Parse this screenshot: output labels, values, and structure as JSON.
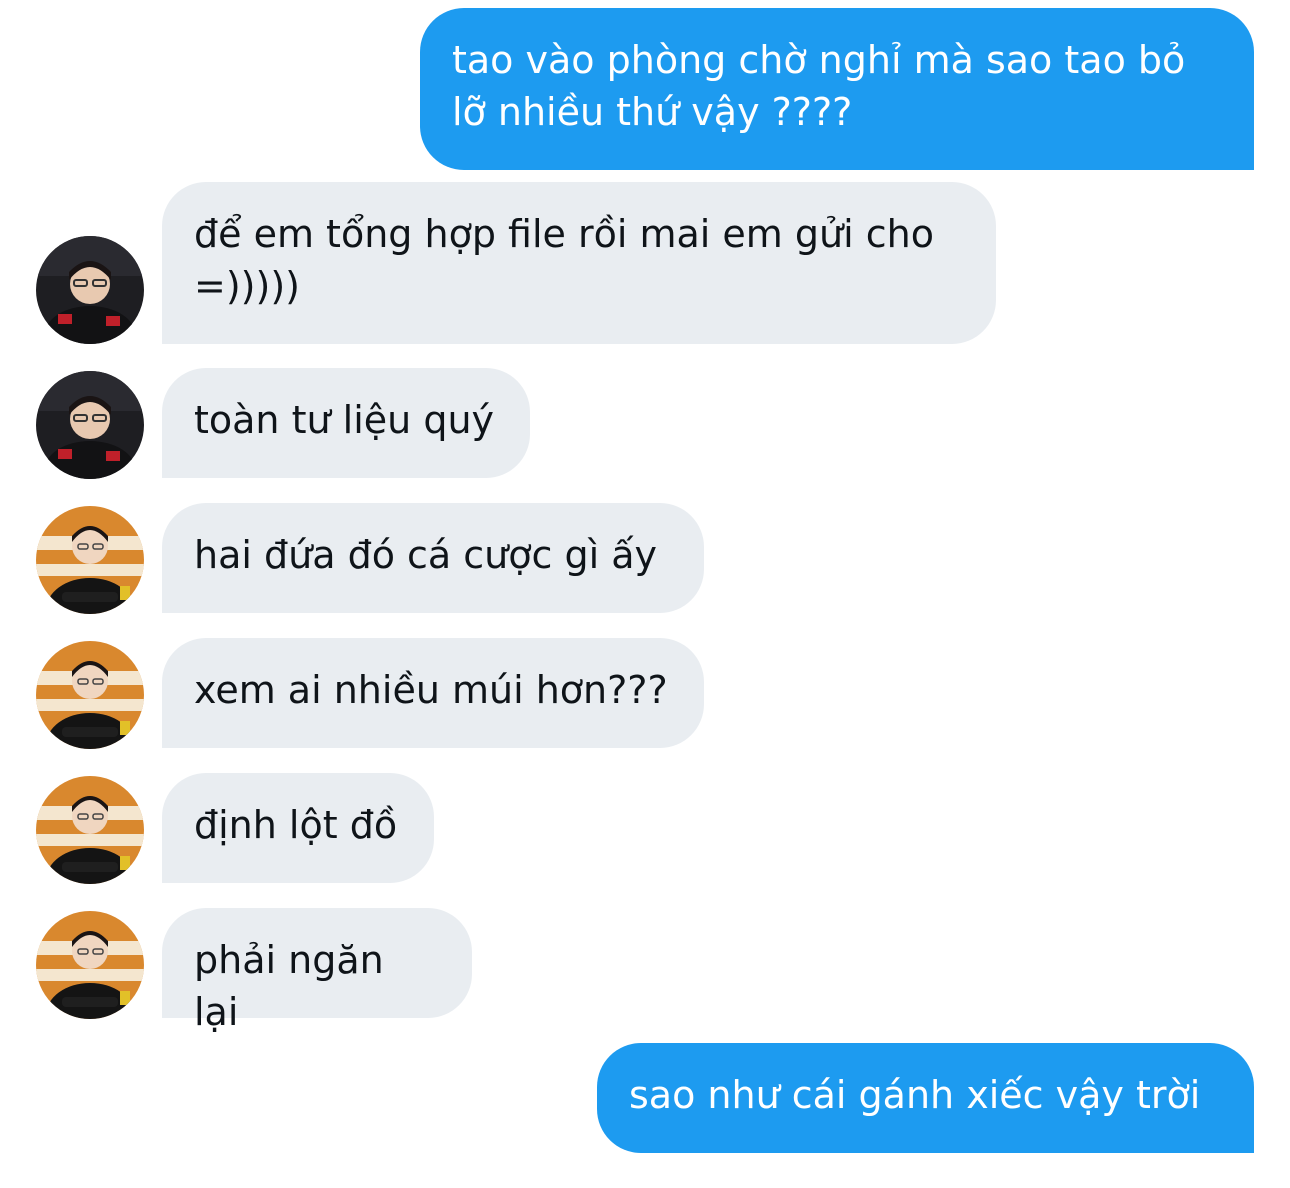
{
  "conversation": {
    "messages": [
      {
        "side": "sent",
        "text": "tao vào phòng chờ nghỉ mà sao tao bỏ lỡ nhiều thứ vậy ????"
      },
      {
        "side": "received",
        "avatar": "user-a",
        "text": "để em tổng hợp file rồi mai em gửi cho =)))))"
      },
      {
        "side": "received",
        "avatar": "user-a",
        "text": "toàn tư liệu quý"
      },
      {
        "side": "received",
        "avatar": "user-b",
        "text": "hai đứa đó cá cược gì ấy"
      },
      {
        "side": "received",
        "avatar": "user-b",
        "text": "xem ai nhiều múi hơn???"
      },
      {
        "side": "received",
        "avatar": "user-b",
        "text": "định lột đồ"
      },
      {
        "side": "received",
        "avatar": "user-b",
        "text": "phải ngăn lại"
      },
      {
        "side": "sent",
        "text": "sao như cái gánh xiếc vậy trời"
      }
    ]
  },
  "colors": {
    "sent_bubble": "#1d9bf0",
    "received_bubble": "#e9edf1",
    "sent_text": "#ffffff",
    "received_text": "#0f1419"
  }
}
